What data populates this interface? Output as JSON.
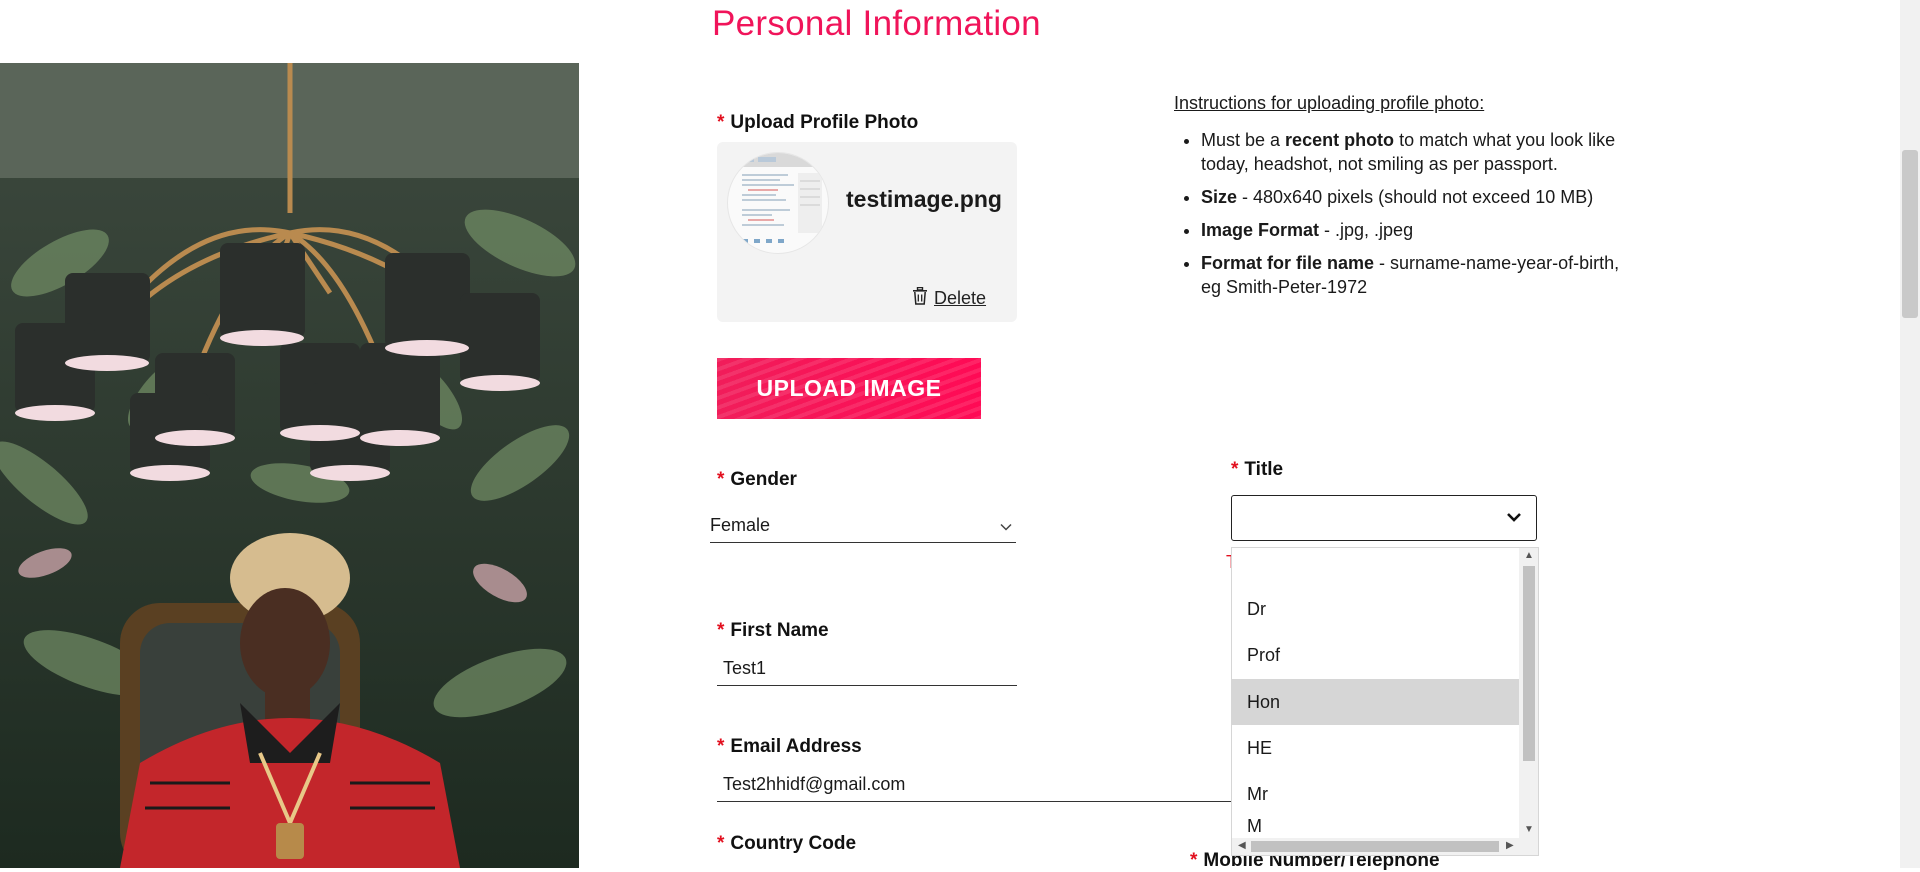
{
  "page": {
    "title": "Personal Information"
  },
  "upload": {
    "label": "Upload Profile Photo",
    "file_name": "testimage.png",
    "delete_label": "Delete",
    "button_label": "UPLOAD IMAGE"
  },
  "instructions": {
    "heading": "Instructions for uploading profile photo:",
    "items": [
      {
        "lead": "Must be a ",
        "bold": "recent photo",
        "rest": " to match what you look like today, headshot, not smiling as per passport."
      },
      {
        "lead": "",
        "bold": "Size",
        "rest": " - 480x640 pixels (should not exceed 10 MB)"
      },
      {
        "lead": "",
        "bold": "Image Format",
        "rest": " - .jpg, .jpeg"
      },
      {
        "lead": "",
        "bold": "Format for file name",
        "rest": " - surname-name-year-of-birth, eg Smith-Peter-1972"
      }
    ]
  },
  "form": {
    "required_mark": "*",
    "gender": {
      "label": "Gender",
      "value": "Female"
    },
    "title": {
      "label": "Title",
      "value": "",
      "error_fragment": "T",
      "options": [
        "",
        "Dr",
        "Prof",
        "Hon",
        "HE",
        "Mr",
        "M"
      ],
      "highlighted": "Hon"
    },
    "first_name": {
      "label": "First Name",
      "value": "Test1"
    },
    "email": {
      "label": "Email Address",
      "value": "Test2hhidf@gmail.com"
    },
    "country_code": {
      "label": "Country Code"
    },
    "mobile": {
      "label": "Mobile Number/Telephone"
    }
  },
  "icons": {
    "chevron": "chevron-down-icon",
    "trash": "trash-icon"
  },
  "colors": {
    "accent": "#f0145a",
    "required": "#e2101f",
    "highlight": "#d6d6d6"
  }
}
